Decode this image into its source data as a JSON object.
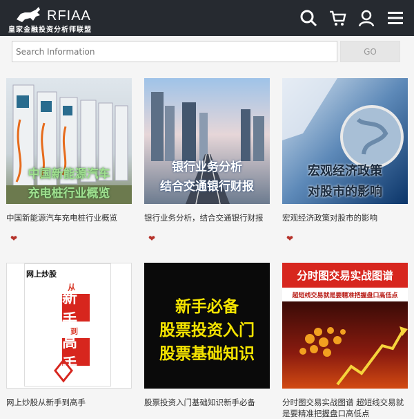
{
  "header": {
    "brand": "RFIAA",
    "subtitle": "皇家金融投资分析师联盟",
    "icons": [
      "search-icon",
      "cart-icon",
      "user-icon",
      "menu-icon"
    ]
  },
  "search": {
    "placeholder": "Search Information",
    "button": "GO"
  },
  "cards": [
    {
      "title": "中国新能源汽车充电桩行业概览",
      "overlay": [
        "中国新能源汽车",
        "充电桩行业概览"
      ]
    },
    {
      "title": "银行业务分析，结合交通银行财报",
      "overlay": [
        "银行业务分析",
        "结合交通银行财报"
      ]
    },
    {
      "title": "宏观经济政策对股市的影响",
      "overlay": [
        "宏观经济政策",
        "对股市的影响"
      ]
    },
    {
      "title": "网上炒股从新手到高手",
      "overlay": [
        "网上炒股",
        "从",
        "新手",
        "到",
        "高手"
      ]
    },
    {
      "title": "股票投资入门基础知识新手必备",
      "overlay": [
        "新手必备",
        "股票投资入门",
        "股票基础知识"
      ]
    },
    {
      "title": "分时图交易实战图谱 超短线交易就是要精准把握盘口高低点",
      "overlay": [
        "分时图交易实战图谱",
        "超短线交易就是要精准把握盘口高低点"
      ]
    }
  ],
  "colors": {
    "topbar": "#262a30",
    "accent": "#b5322a"
  }
}
